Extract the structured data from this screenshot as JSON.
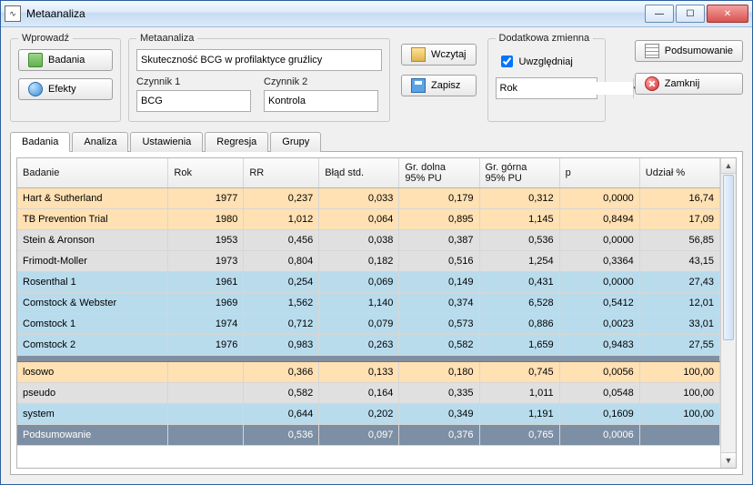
{
  "window": {
    "title": "Metaanaliza"
  },
  "panels": {
    "wprowadz": {
      "legend": "Wprowadź",
      "badania_btn": "Badania",
      "efekty_btn": "Efekty"
    },
    "meta": {
      "legend": "Metaanaliza",
      "name_value": "Skuteczność BCG w profilaktyce gruźlicy",
      "czynnik1_label": "Czynnik 1",
      "czynnik1_value": "BCG",
      "czynnik2_label": "Czynnik 2",
      "czynnik2_value": "Kontrola"
    },
    "file": {
      "wczytaj": "Wczytaj",
      "zapisz": "Zapisz"
    },
    "extra": {
      "legend": "Dodatkowa zmienna",
      "uwzgl_label": "Uwzględniaj",
      "uwzgl_checked": true,
      "combo_value": "Rok"
    },
    "right": {
      "podsumowanie": "Podsumowanie",
      "zamknij": "Zamknij"
    }
  },
  "tabs": {
    "items": [
      "Badania",
      "Analiza",
      "Ustawienia",
      "Regresja",
      "Grupy"
    ],
    "active": 0
  },
  "grid": {
    "headers": {
      "badanie": "Badanie",
      "rok": "Rok",
      "rr": "RR",
      "blad": "Błąd std.",
      "dolna": "Gr. dolna\n95% PU",
      "gorna": "Gr. górna\n95% PU",
      "p": "p",
      "udzial": "Udział %"
    },
    "rows": [
      {
        "type": "orange",
        "badanie": "Hart & Sutherland",
        "rok": "1977",
        "rr": "0,237",
        "blad": "0,033",
        "dolna": "0,179",
        "gorna": "0,312",
        "p": "0,0000",
        "udzial": "16,74"
      },
      {
        "type": "orange",
        "badanie": "TB Prevention Trial",
        "rok": "1980",
        "rr": "1,012",
        "blad": "0,064",
        "dolna": "0,895",
        "gorna": "1,145",
        "p": "0,8494",
        "udzial": "17,09"
      },
      {
        "type": "gray",
        "badanie": "Stein & Aronson",
        "rok": "1953",
        "rr": "0,456",
        "blad": "0,038",
        "dolna": "0,387",
        "gorna": "0,536",
        "p": "0,0000",
        "udzial": "56,85"
      },
      {
        "type": "gray",
        "badanie": "Frimodt-Moller",
        "rok": "1973",
        "rr": "0,804",
        "blad": "0,182",
        "dolna": "0,516",
        "gorna": "1,254",
        "p": "0,3364",
        "udzial": "43,15"
      },
      {
        "type": "blue",
        "badanie": "Rosenthal 1",
        "rok": "1961",
        "rr": "0,254",
        "blad": "0,069",
        "dolna": "0,149",
        "gorna": "0,431",
        "p": "0,0000",
        "udzial": "27,43"
      },
      {
        "type": "blue",
        "badanie": "Comstock & Webster",
        "rok": "1969",
        "rr": "1,562",
        "blad": "1,140",
        "dolna": "0,374",
        "gorna": "6,528",
        "p": "0,5412",
        "udzial": "12,01"
      },
      {
        "type": "blue",
        "badanie": "Comstock 1",
        "rok": "1974",
        "rr": "0,712",
        "blad": "0,079",
        "dolna": "0,573",
        "gorna": "0,886",
        "p": "0,0023",
        "udzial": "33,01"
      },
      {
        "type": "blue",
        "badanie": "Comstock 2",
        "rok": "1976",
        "rr": "0,983",
        "blad": "0,263",
        "dolna": "0,582",
        "gorna": "1,659",
        "p": "0,9483",
        "udzial": "27,55"
      },
      {
        "type": "spacer"
      },
      {
        "type": "orange",
        "badanie": "losowo",
        "rok": "",
        "rr": "0,366",
        "blad": "0,133",
        "dolna": "0,180",
        "gorna": "0,745",
        "p": "0,0056",
        "udzial": "100,00"
      },
      {
        "type": "gray",
        "badanie": "pseudo",
        "rok": "",
        "rr": "0,582",
        "blad": "0,164",
        "dolna": "0,335",
        "gorna": "1,011",
        "p": "0,0548",
        "udzial": "100,00"
      },
      {
        "type": "blue",
        "badanie": "system",
        "rok": "",
        "rr": "0,644",
        "blad": "0,202",
        "dolna": "0,349",
        "gorna": "1,191",
        "p": "0,1609",
        "udzial": "100,00"
      },
      {
        "type": "sum",
        "badanie": "Podsumowanie",
        "rok": "",
        "rr": "0,536",
        "blad": "0,097",
        "dolna": "0,376",
        "gorna": "0,765",
        "p": "0,0006",
        "udzial": ""
      }
    ]
  }
}
